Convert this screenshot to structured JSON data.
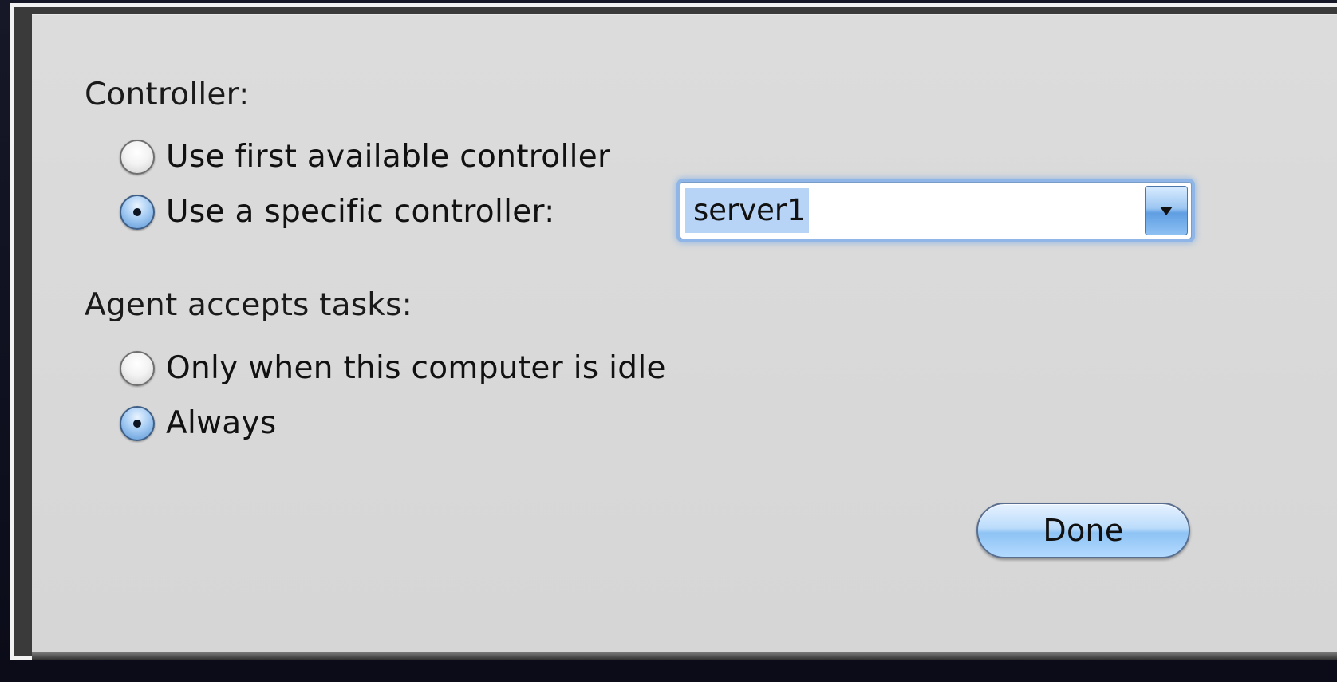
{
  "dialog": {
    "controller_section": {
      "label": "Controller:",
      "options": [
        {
          "label": "Use first available controller",
          "checked": false
        },
        {
          "label": "Use a specific controller:",
          "checked": true
        }
      ],
      "controller_select": {
        "value": "server1",
        "text_selected": true
      }
    },
    "tasks_section": {
      "label": "Agent accepts tasks:",
      "options": [
        {
          "label": "Only when this computer is idle",
          "checked": false
        },
        {
          "label": "Always",
          "checked": true
        }
      ]
    },
    "done_button": {
      "label": "Done"
    }
  },
  "icons": {
    "radio": "radio-button",
    "combo_arrow": "chevron-down-icon"
  },
  "colors": {
    "accent": "#5c97d6",
    "selection": "#b7d4f7",
    "sheet_background": "#d9d9d9",
    "desktop_background": "#141626"
  }
}
